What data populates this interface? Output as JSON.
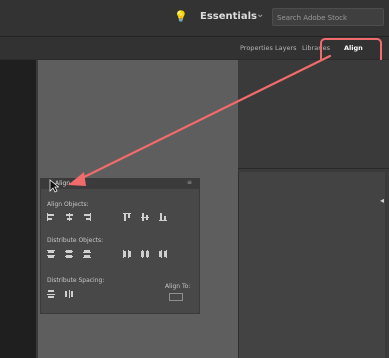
{
  "topbar": {
    "workspace_label": "Essentials",
    "workspace_chevron": "⌄",
    "lightbulb_icon": "lightbulb-icon",
    "search_placeholder": "Search Adobe Stock"
  },
  "dock_tabs": [
    "Properties",
    "Layers",
    "Libraries",
    "Align"
  ],
  "active_tab": "Align",
  "align_panel": {
    "title": "Align",
    "sections": {
      "align_objects": "Align Objects:",
      "distribute_objects": "Distribute Objects:",
      "distribute_spacing": "Distribute Spacing:",
      "align_to": "Align To:"
    },
    "menu_icon": "≡"
  },
  "colors": {
    "callout": "#f06b6b",
    "chrome": "#333333",
    "canvas": "#5e5e5e"
  },
  "right_panel_arrow": "◂"
}
